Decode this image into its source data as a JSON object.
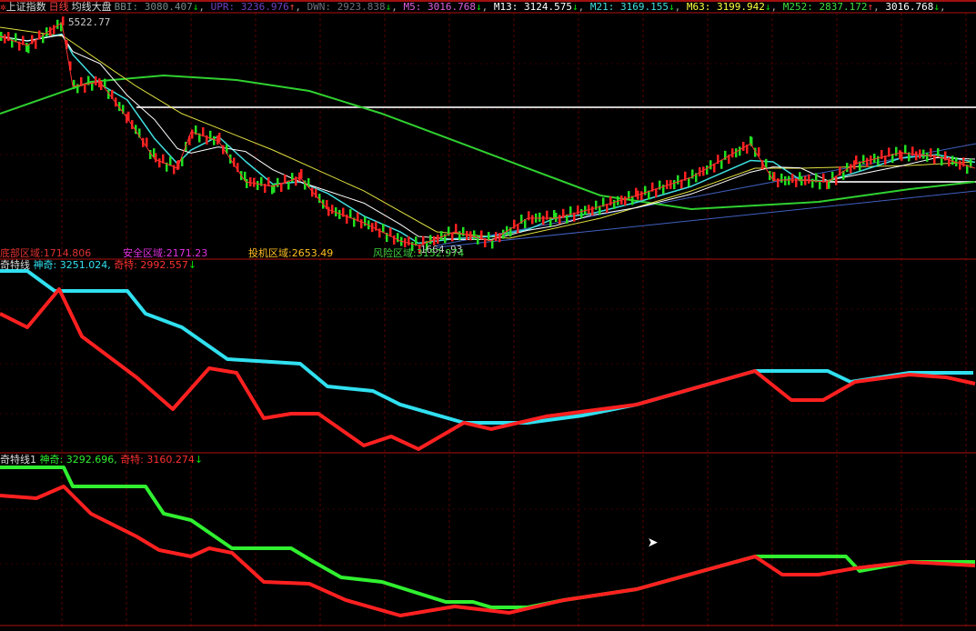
{
  "header": {
    "title": "上证指数",
    "period": "日线",
    "indicator": "均线大盘",
    "items": [
      {
        "label": "BBI: 3080.407",
        "arrow": "↓",
        "color": "#7a8a8a",
        "arrow_color": "#00e000"
      },
      {
        "label": "UPR: 3236.976",
        "arrow": "↑",
        "color": "#7040c0",
        "arrow_color": "#ff4040"
      },
      {
        "label": "DWN: 2923.838",
        "arrow": "↓",
        "color": "#707080",
        "arrow_color": "#00e000"
      },
      {
        "label": "M5: 3016.768",
        "arrow": "↓",
        "color": "#e060e0",
        "arrow_color": "#00e000"
      },
      {
        "label": "M13: 3124.575",
        "arrow": "↓",
        "color": "#ffffff",
        "arrow_color": "#00e000"
      },
      {
        "label": "M21: 3169.155",
        "arrow": "↓",
        "color": "#40e0e0",
        "arrow_color": "#00e000"
      },
      {
        "label": "M63: 3199.942",
        "arrow": "↓",
        "color": "#ffff40",
        "arrow_color": "#00e000"
      },
      {
        "label": "M252: 2837.172",
        "arrow": "↑",
        "color": "#40e040",
        "arrow_color": "#ff4040"
      },
      {
        "label": "3016.768",
        "arrow": "↓",
        "color": "#ffffff",
        "arrow_color": "#00e000"
      }
    ],
    "high_label": "5522.77",
    "low_label": "1664.93"
  },
  "zones": [
    {
      "label": "底部区域:1714.806",
      "color": "#e03030"
    },
    {
      "label": "安全区域:2171.23",
      "color": "#e030e0"
    },
    {
      "label": "投机区域:2653.49",
      "color": "#ffc020"
    },
    {
      "label": "风险区域:3152.974",
      "color": "#40d040"
    }
  ],
  "panel2": {
    "name": "奇特线",
    "s1": "神奇: 3251.024,",
    "s2": "奇特: 2992.557",
    "arrow": "↓"
  },
  "panel3": {
    "name": "奇特线1",
    "s1": "神奇: 3292.696,",
    "s2": "奇特: 3160.274",
    "arrow": "↓"
  },
  "chart_data": [
    {
      "type": "line",
      "title": "上证指数 日线 均线大盘",
      "x": [
        0,
        3,
        6.8,
        8,
        11,
        14,
        17,
        19.5,
        21,
        24,
        27,
        30,
        33,
        36,
        40,
        44,
        46,
        50,
        54,
        58,
        61,
        65,
        70,
        76,
        82.5,
        85,
        88,
        91,
        94,
        99,
        103,
        107.3
      ],
      "series": [
        {
          "name": "price",
          "color": "#ff3030",
          "values": [
            5286,
            5128,
            5522,
            4420,
            4498,
            3868,
            3160,
            3002,
            3632,
            3475,
            2766,
            2687,
            2845,
            2293,
            2057,
            1742,
            1664,
            1900,
            1742,
            2136,
            2136,
            2293,
            2530,
            2845,
            3427,
            2798,
            2798,
            2766,
            3081,
            3270,
            3207,
            3002
          ]
        }
      ],
      "ma": [
        {
          "name": "M252",
          "color": "#30d030",
          "x": [
            0,
            10,
            18,
            26,
            34,
            42,
            50,
            58,
            66,
            76,
            90,
            100,
            107.3
          ],
          "values": [
            3947,
            4498,
            4609,
            4530,
            4341,
            3947,
            3475,
            3002,
            2530,
            2293,
            2419,
            2640,
            2766
          ]
        },
        {
          "name": "M63",
          "color": "#e0e040",
          "x": [
            0,
            7,
            15,
            20,
            30,
            40,
            48,
            56,
            66,
            76,
            83,
            88,
            100,
            107.3
          ],
          "values": [
            5443,
            5286,
            4420,
            3947,
            3317,
            2609,
            1900,
            1790,
            2136,
            2609,
            3002,
            3002,
            3049,
            3112
          ]
        }
      ],
      "hlines": [
        4057,
        2766
      ],
      "ylim": [
        1500,
        5600
      ]
    },
    {
      "type": "line",
      "title": "奇特线",
      "series": [
        {
          "name": "神奇",
          "color": "#30e0f0",
          "x": [
            0,
            3,
            6,
            14,
            16,
            20,
            25,
            33,
            36,
            41,
            44,
            51,
            58,
            64,
            70,
            83,
            91,
            93.5,
            100,
            107
          ],
          "values": [
            5390,
            5390,
            4970,
            4970,
            4493,
            4206,
            3538,
            3442,
            2964,
            2869,
            2583,
            2201,
            2201,
            2353,
            2583,
            3289,
            3289,
            3060,
            3251,
            3251
          ]
        },
        {
          "name": "奇特",
          "color": "#ff2020",
          "x": [
            0,
            3,
            6.5,
            9,
            15,
            19,
            23,
            26,
            29,
            32,
            35,
            40,
            43,
            46,
            51,
            54,
            60,
            70,
            83,
            87,
            90.5,
            94,
            100,
            104,
            107.3
          ],
          "values": [
            4493,
            4206,
            5008,
            4015,
            3156,
            2487,
            3347,
            3251,
            2296,
            2392,
            2392,
            1723,
            1914,
            1647,
            2201,
            2067,
            2334,
            2583,
            3289,
            2678,
            2678,
            3060,
            3213,
            3156,
            3022
          ]
        }
      ]
    },
    {
      "type": "line",
      "title": "奇特线1",
      "series": [
        {
          "name": "神奇",
          "color": "#30f030",
          "x": [
            0,
            7,
            8,
            16,
            18,
            21,
            25.5,
            32,
            34.5,
            37.5,
            42,
            49,
            52,
            54,
            58,
            62,
            70,
            83,
            93,
            94.5,
            100,
            107.3
          ],
          "values": [
            5289,
            5289,
            4886,
            4886,
            4310,
            4175,
            3580,
            3580,
            3292,
            2966,
            2870,
            2447,
            2447,
            2332,
            2332,
            2486,
            2716,
            3407,
            3407,
            3100,
            3292,
            3292
          ]
        },
        {
          "name": "奇特",
          "color": "#ff2020",
          "x": [
            0,
            4,
            7,
            10,
            15,
            17.5,
            21,
            23,
            25.5,
            29,
            34,
            38,
            44,
            50,
            56,
            62,
            70,
            83,
            86,
            90,
            94,
            100,
            107.3
          ],
          "values": [
            4694,
            4636,
            4886,
            4310,
            3830,
            3542,
            3407,
            3580,
            3484,
            2870,
            2831,
            2486,
            2159,
            2351,
            2217,
            2486,
            2716,
            3407,
            3023,
            3023,
            3158,
            3292,
            3215
          ]
        }
      ]
    }
  ]
}
